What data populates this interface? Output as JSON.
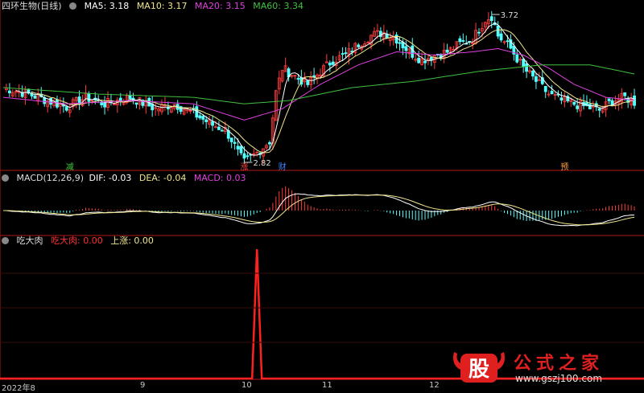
{
  "header1": {
    "title": "四环生物(日线)",
    "ma": [
      {
        "label": "MA5: 3.18",
        "color": "#ffffff"
      },
      {
        "label": "MA10: 3.17",
        "color": "#f0e68c"
      },
      {
        "label": "MA20: 3.15",
        "color": "#e040e0"
      },
      {
        "label": "MA60: 3.34",
        "color": "#40c040"
      }
    ]
  },
  "header2": {
    "macd_label": "MACD(12,26,9)",
    "dif": "DIF: -0.03",
    "dea": "DEA: -0.04",
    "macd": "MACD: 0.03"
  },
  "header3": {
    "name": "吃大肉",
    "val1": "吃大肉: 0.00",
    "val2": "上涨: 0.00"
  },
  "price_labels": {
    "high": "3.72",
    "low": "2.82"
  },
  "signals": [
    {
      "text": "减",
      "color": "#40d040",
      "bar": 21
    },
    {
      "text": "涨",
      "color": "#ff4040",
      "bar": 76
    },
    {
      "text": "财",
      "color": "#4080ff",
      "bar": 88
    },
    {
      "text": "预",
      "color": "#ffa040",
      "bar": 177
    }
  ],
  "x_labels": [
    "2022年8",
    "9",
    "10",
    "11",
    "12"
  ],
  "watermark": {
    "main": "公式之家",
    "url": "www.gszj100.com",
    "logo": "股"
  },
  "colors": {
    "up": "#ff3c3c",
    "down": "#54ffff",
    "ma5": "#ffffff",
    "ma10": "#f0e68c",
    "ma20": "#e040e0",
    "ma60": "#40c040",
    "dif": "#ffffff",
    "dea": "#f0e68c",
    "spike": "#ff2020",
    "divider": "#b01818"
  },
  "chart_data": {
    "type": "line",
    "panels": [
      "price",
      "macd",
      "indicator"
    ],
    "price_range": [
      2.82,
      3.72
    ],
    "series": [
      {
        "name": "MA5",
        "last": 3.18
      },
      {
        "name": "MA10",
        "last": 3.17
      },
      {
        "name": "MA20",
        "last": 3.15
      },
      {
        "name": "MA60",
        "last": 3.34
      }
    ],
    "macd": {
      "dif": -0.03,
      "dea": -0.04,
      "macd": 0.03
    },
    "indicator": {
      "吃大肉": 0.0,
      "上涨": 0.0
    },
    "close_path": [
      [
        0,
        3.28
      ],
      [
        8,
        3.24
      ],
      [
        14,
        3.2
      ],
      [
        20,
        3.16
      ],
      [
        26,
        3.22
      ],
      [
        32,
        3.18
      ],
      [
        40,
        3.22
      ],
      [
        48,
        3.15
      ],
      [
        54,
        3.18
      ],
      [
        60,
        3.12
      ],
      [
        66,
        3.05
      ],
      [
        70,
        3.02
      ],
      [
        72,
        2.96
      ],
      [
        74,
        2.88
      ],
      [
        76,
        2.82
      ],
      [
        80,
        2.88
      ],
      [
        84,
        2.95
      ],
      [
        86,
        3.25
      ],
      [
        88,
        3.4
      ],
      [
        92,
        3.35
      ],
      [
        96,
        3.3
      ],
      [
        100,
        3.38
      ],
      [
        104,
        3.45
      ],
      [
        108,
        3.48
      ],
      [
        112,
        3.55
      ],
      [
        116,
        3.6
      ],
      [
        120,
        3.62
      ],
      [
        124,
        3.58
      ],
      [
        128,
        3.5
      ],
      [
        132,
        3.45
      ],
      [
        136,
        3.48
      ],
      [
        140,
        3.5
      ],
      [
        144,
        3.55
      ],
      [
        148,
        3.58
      ],
      [
        152,
        3.7
      ],
      [
        154,
        3.72
      ],
      [
        156,
        3.6
      ],
      [
        160,
        3.52
      ],
      [
        164,
        3.4
      ],
      [
        168,
        3.32
      ],
      [
        172,
        3.24
      ],
      [
        176,
        3.2
      ],
      [
        180,
        3.18
      ],
      [
        184,
        3.16
      ],
      [
        188,
        3.14
      ],
      [
        192,
        3.2
      ],
      [
        196,
        3.22
      ],
      [
        200,
        3.18
      ]
    ],
    "ma20_path": [
      [
        0,
        3.22
      ],
      [
        20,
        3.18
      ],
      [
        40,
        3.2
      ],
      [
        60,
        3.18
      ],
      [
        76,
        3.08
      ],
      [
        88,
        3.15
      ],
      [
        100,
        3.3
      ],
      [
        112,
        3.42
      ],
      [
        124,
        3.5
      ],
      [
        136,
        3.48
      ],
      [
        148,
        3.5
      ],
      [
        156,
        3.52
      ],
      [
        164,
        3.48
      ],
      [
        172,
        3.4
      ],
      [
        180,
        3.3
      ],
      [
        190,
        3.22
      ],
      [
        200,
        3.2
      ]
    ],
    "ma60_path": [
      [
        0,
        3.28
      ],
      [
        30,
        3.24
      ],
      [
        60,
        3.22
      ],
      [
        76,
        3.18
      ],
      [
        90,
        3.2
      ],
      [
        110,
        3.28
      ],
      [
        130,
        3.32
      ],
      [
        150,
        3.38
      ],
      [
        170,
        3.42
      ],
      [
        185,
        3.42
      ],
      [
        200,
        3.36
      ]
    ],
    "spike_bar": 80
  }
}
